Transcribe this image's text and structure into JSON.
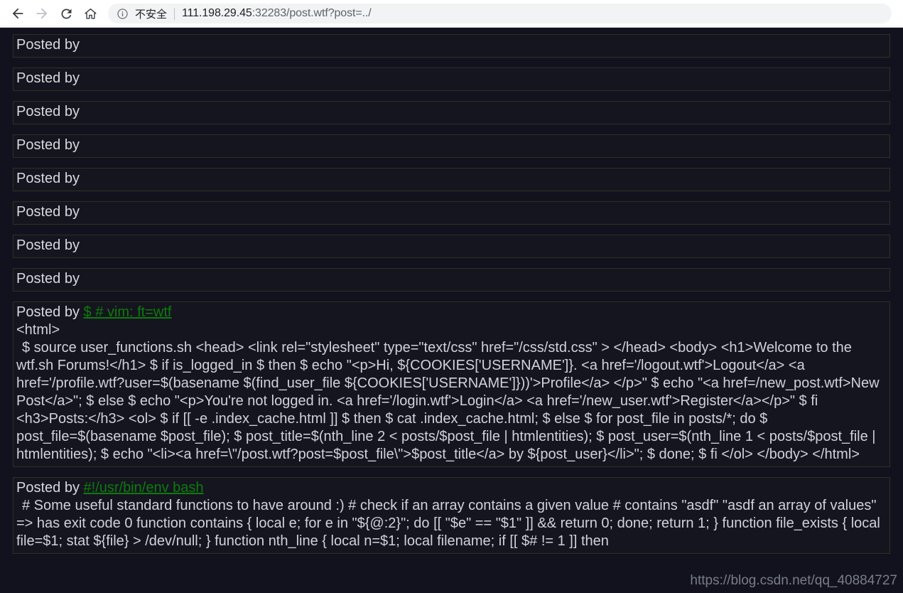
{
  "browser": {
    "back_icon": "back-arrow-icon",
    "forward_icon": "forward-arrow-icon",
    "reload_icon": "reload-icon",
    "home_icon": "home-icon",
    "info_icon": "info-circle-icon",
    "security_label": "不安全",
    "url_host": "111.198.29.45",
    "url_rest": ":32283/post.wtf?post=../",
    "url_full": "111.198.29.45:32283/post.wtf?post=../"
  },
  "colors": {
    "page_background": "#12121f",
    "post_background": "#15151f",
    "post_border": "#2f2f22",
    "text": "#d7d9e0",
    "link": "#0d7b0d",
    "chrome_background": "#ffffff",
    "omnibox_background": "#f1f3f4"
  },
  "posts": [
    {
      "posted_by_label": "Posted by",
      "author": "",
      "body": []
    },
    {
      "posted_by_label": "Posted by",
      "author": "",
      "body": []
    },
    {
      "posted_by_label": "Posted by",
      "author": "",
      "body": []
    },
    {
      "posted_by_label": "Posted by",
      "author": "",
      "body": []
    },
    {
      "posted_by_label": "Posted by",
      "author": "",
      "body": []
    },
    {
      "posted_by_label": "Posted by",
      "author": "",
      "body": []
    },
    {
      "posted_by_label": "Posted by",
      "author": "",
      "body": []
    },
    {
      "posted_by_label": "Posted by",
      "author": "",
      "body": []
    },
    {
      "posted_by_label": "Posted by",
      "author": "$ # vim: ft=wtf",
      "body": [
        "<html>",
        "$ source user_functions.sh <head> <link rel=\"stylesheet\" type=\"text/css\" href=\"/css/std.css\" > </head> <body> <h1>Welcome to the wtf.sh Forums!</h1> $ if is_logged_in $ then $ echo \"<p>Hi, ${COOKIES['USERNAME']}. <a href='/logout.wtf'>Logout</a> <a href='/profile.wtf?user=$(basename $(find_user_file ${COOKIES['USERNAME']}))'>Profile</a> </p>\" $ echo \"<a href=/new_post.wtf>New Post</a>\"; $ else $ echo \"<p>You're not logged in. <a href='/login.wtf'>Login</a> <a href='/new_user.wtf'>Register</a></p>\" $ fi <h3>Posts:</h3> <ol> $ if [[ -e .index_cache.html ]] $ then $ cat .index_cache.html; $ else $ for post_file in posts/*; do $ post_file=$(basename $post_file); $ post_title=$(nth_line 2 < posts/$post_file | htmlentities); $ post_user=$(nth_line 1 < posts/$post_file | htmlentities); $ echo \"<li><a href=\\\"/post.wtf?post=$post_file\\\">$post_title</a> by ${post_user}</li>\"; $ done; $ fi </ol> </body> </html>"
      ]
    },
    {
      "posted_by_label": "Posted by",
      "author": "#!/usr/bin/env bash",
      "body": [
        "# Some useful standard functions to have around :) # check if an array contains a given value # contains \"asdf\" \"asdf an array of values\" => has exit code 0 function contains { local e; for e in \"${@:2}\"; do [[ \"$e\" == \"$1\" ]] && return 0; done; return 1; } function file_exists { local file=$1; stat ${file} > /dev/null; } function nth_line { local n=$1; local filename; if [[ $# != 1 ]] then"
      ]
    }
  ],
  "watermark": "https://blog.csdn.net/qq_40884727"
}
